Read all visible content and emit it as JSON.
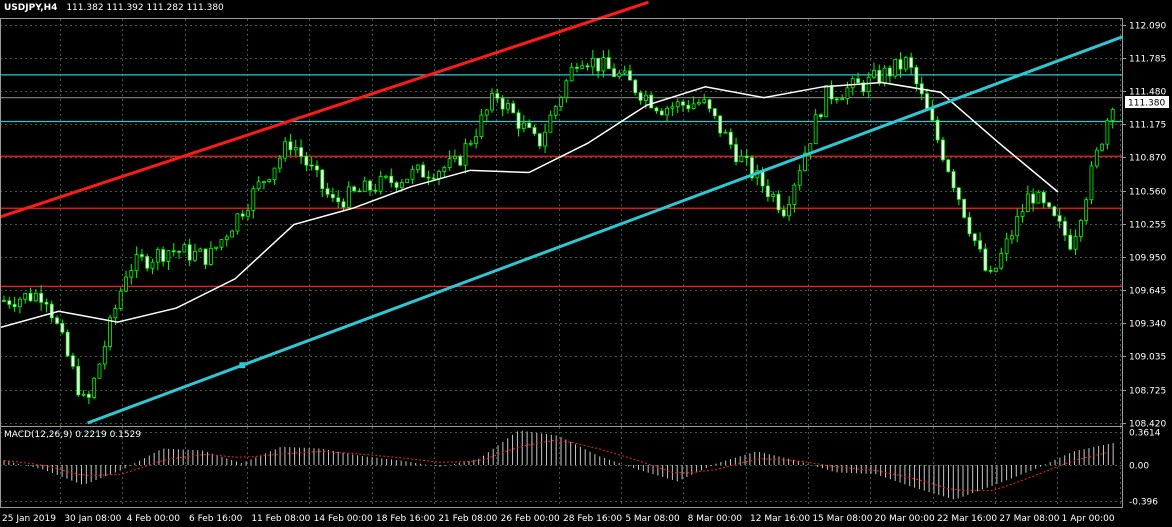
{
  "header": {
    "symbol": "USDJPY,H4",
    "ohlc": "111.382 111.392 111.282 111.380"
  },
  "indicator": {
    "label": "MACD(12,26,9) 0.2219 0.1529"
  },
  "colors": {
    "background": "#000000",
    "grid": "#3a5f3a",
    "candle": "#00ff00",
    "moving_average": "#ffffff",
    "trend_red": "#ff1a1a",
    "trend_cyan": "#2ec7d3",
    "macd_hist": "#c8c8c8",
    "macd_signal": "#ff2020"
  },
  "chart_data": [
    {
      "type": "line",
      "title": "USDJPY,H4",
      "x": [
        "25 Jan 2019",
        "30 Jan 08:00",
        "4 Feb 00:00",
        "6 Feb 16:00",
        "11 Feb 08:00",
        "14 Feb 00:00",
        "18 Feb 16:00",
        "21 Feb 08:00",
        "26 Feb 00:00",
        "28 Feb 16:00",
        "5 Mar 08:00",
        "8 Mar 00:00",
        "12 Mar 16:00",
        "15 Mar 08:00",
        "20 Mar 00:00",
        "22 Mar 16:00",
        "27 Mar 08:00",
        "1 Apr 00:00"
      ],
      "ylim": [
        108.42,
        112.09
      ],
      "yticks": [
        "112.090",
        "111.785",
        "111.480",
        "111.175",
        "110.870",
        "110.560",
        "110.255",
        "109.950",
        "109.645",
        "109.340",
        "109.035",
        "108.725",
        "108.420"
      ],
      "series": [
        {
          "name": "",
          "values": [
            109.55,
            109.62,
            108.55,
            109.85,
            110.02,
            109.95,
            110.5,
            111.02,
            110.45,
            110.6,
            110.72,
            110.8,
            111.45,
            110.98,
            111.82,
            111.62,
            111.33,
            111.38,
            110.82,
            110.4,
            111.44,
            111.55,
            111.75,
            110.78,
            109.72,
            110.55,
            110.08,
            111.4
          ]
        },
        {
          "name": "",
          "values": [
            109.3,
            109.45,
            109.35,
            109.48,
            109.75,
            110.25,
            110.4,
            110.6,
            110.75,
            110.73,
            111.0,
            111.35,
            111.52,
            111.42,
            111.52,
            111.56,
            111.47,
            111.0,
            110.55
          ]
        }
      ],
      "horizontal_lines": [
        {
          "value": 111.63,
          "color": "cyan"
        },
        {
          "value": 111.42,
          "color": "grey"
        },
        {
          "value": 111.2,
          "color": "cyan"
        },
        {
          "value": 110.88,
          "color": "red"
        },
        {
          "value": 110.4,
          "color": "red"
        },
        {
          "value": 109.68,
          "color": "red"
        }
      ],
      "trendlines": [
        {
          "color": "red",
          "from": [
            0,
            110.32
          ],
          "to": [
            0.578,
            112.3
          ]
        },
        {
          "color": "cyan",
          "from": [
            0.078,
            108.42
          ],
          "to": [
            1.0,
            111.98
          ]
        }
      ],
      "current_price": "111.380",
      "grid": true
    },
    {
      "type": "bar",
      "title": "MACD(12,26,9)",
      "ylim": [
        -0.396,
        0.3614
      ],
      "yticks": [
        "0.3614",
        "0.00",
        "-0.396"
      ],
      "series": [
        {
          "name": "MACD",
          "values": [
            0.05,
            -0.05,
            -0.22,
            -0.05,
            0.18,
            0.16,
            0.02,
            0.2,
            0.18,
            0.1,
            0.05,
            -0.02,
            0.07,
            0.38,
            0.32,
            0.1,
            -0.05,
            -0.18,
            0.02,
            0.15,
            0.05,
            -0.08,
            -0.1,
            -0.25,
            -0.38,
            -0.22,
            -0.05,
            0.15,
            0.24
          ]
        },
        {
          "name": "Signal",
          "values": [
            0.05,
            0.0,
            -0.12,
            -0.1,
            0.05,
            0.12,
            0.08,
            0.12,
            0.15,
            0.12,
            0.08,
            0.03,
            0.04,
            0.2,
            0.28,
            0.18,
            0.05,
            -0.1,
            -0.05,
            0.07,
            0.05,
            -0.02,
            -0.06,
            -0.15,
            -0.28,
            -0.28,
            -0.12,
            0.05,
            0.15
          ]
        }
      ]
    }
  ]
}
